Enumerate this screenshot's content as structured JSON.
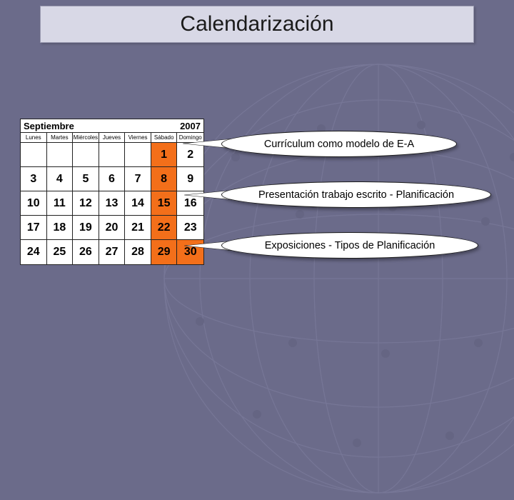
{
  "title": "Calendarización",
  "calendar": {
    "month": "Septiembre",
    "year": "2007",
    "day_headers": [
      "Lunes",
      "Martes",
      "Miércoles",
      "Jueves",
      "Viernes",
      "Sábado",
      "Domingo"
    ],
    "cells": [
      {
        "n": "",
        "hl": false
      },
      {
        "n": "",
        "hl": false
      },
      {
        "n": "",
        "hl": false
      },
      {
        "n": "",
        "hl": false
      },
      {
        "n": "",
        "hl": false
      },
      {
        "n": "1",
        "hl": true
      },
      {
        "n": "2",
        "hl": false
      },
      {
        "n": "3",
        "hl": false
      },
      {
        "n": "4",
        "hl": false
      },
      {
        "n": "5",
        "hl": false
      },
      {
        "n": "6",
        "hl": false
      },
      {
        "n": "7",
        "hl": false
      },
      {
        "n": "8",
        "hl": true
      },
      {
        "n": "9",
        "hl": false
      },
      {
        "n": "10",
        "hl": false
      },
      {
        "n": "11",
        "hl": false
      },
      {
        "n": "12",
        "hl": false
      },
      {
        "n": "13",
        "hl": false
      },
      {
        "n": "14",
        "hl": false
      },
      {
        "n": "15",
        "hl": true
      },
      {
        "n": "16",
        "hl": false
      },
      {
        "n": "17",
        "hl": false
      },
      {
        "n": "18",
        "hl": false
      },
      {
        "n": "19",
        "hl": false
      },
      {
        "n": "20",
        "hl": false
      },
      {
        "n": "21",
        "hl": false
      },
      {
        "n": "22",
        "hl": true
      },
      {
        "n": "23",
        "hl": false
      },
      {
        "n": "24",
        "hl": false
      },
      {
        "n": "25",
        "hl": false
      },
      {
        "n": "26",
        "hl": false
      },
      {
        "n": "27",
        "hl": false
      },
      {
        "n": "28",
        "hl": false
      },
      {
        "n": "29",
        "hl": true
      },
      {
        "n": "30",
        "hl": true
      }
    ]
  },
  "callouts": {
    "c1": "Currículum como modelo de E-A",
    "c2": "Presentación trabajo escrito - Planificación",
    "c3": "Exposiciones  - Tipos de Planificación"
  }
}
